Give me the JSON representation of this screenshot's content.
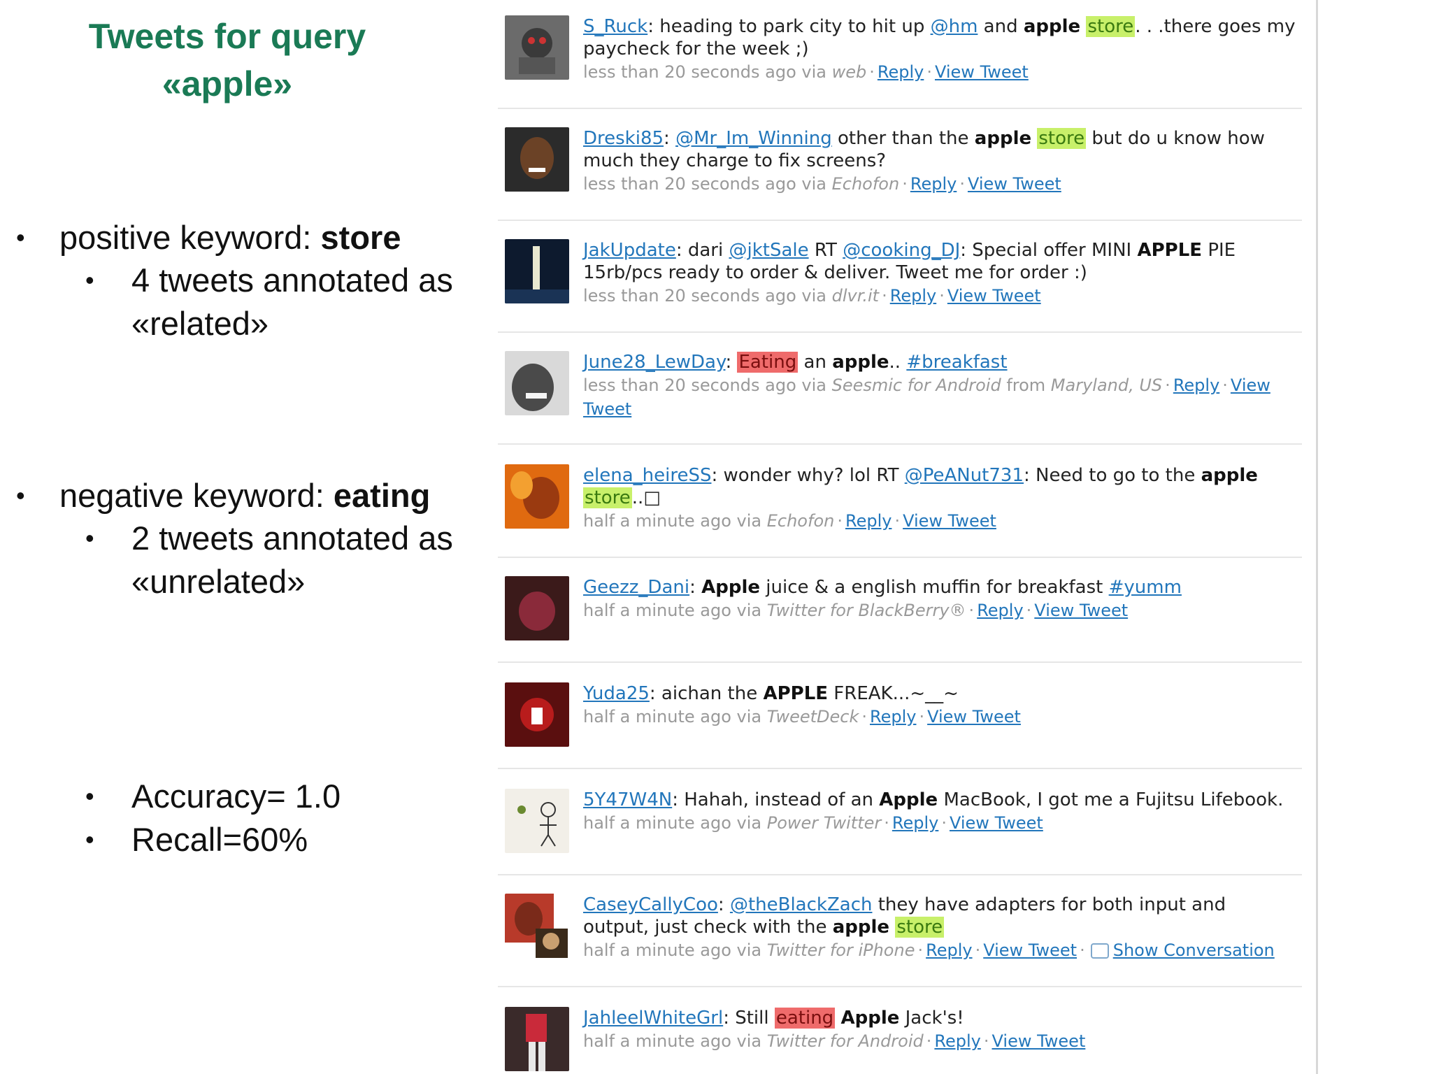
{
  "slide": {
    "title_line1": "Tweets for query",
    "title_line2": "«apple»",
    "positive_label": "positive keyword: ",
    "positive_keyword": "store",
    "positive_sub": "4 tweets annotated as «related»",
    "negative_label": "negative keyword: ",
    "negative_keyword": "eating",
    "negative_sub": "2 tweets annotated as «unrelated»",
    "accuracy": "Accuracy= 1.0",
    "recall": "Recall=60%",
    "bullet": "•"
  },
  "colors": {
    "title": "#1a7a55",
    "link": "#2276bb",
    "highlight_positive": "#c8f06a",
    "highlight_negative": "#ef6b6b"
  },
  "tweets": [
    {
      "user": "S_Ruck",
      "t1": ": heading to park city to hit up ",
      "mention": "@hm",
      "t2": " and ",
      "bold": "apple",
      "hl": "store",
      "t3": ". . .there goes my paycheck for the week ;)",
      "time": "less than 20 seconds ago via ",
      "via": "web",
      "reply": "Reply",
      "view": "View Tweet"
    },
    {
      "user": "Dreski85",
      "mention": "@Mr_Im_Winning",
      "t1": " other than the ",
      "bold": "apple",
      "hl": "store",
      "t2": " but do u know how much they charge to fix screens?",
      "time": "less than 20 seconds ago via ",
      "via": "Echofon",
      "reply": "Reply",
      "view": "View Tweet"
    },
    {
      "user": "JakUpdate",
      "t1": ": dari ",
      "mention1": "@jktSale",
      "t2": " RT ",
      "mention2": "@cooking_DJ",
      "t3": ": Special offer MINI ",
      "bold": "APPLE",
      "t4": " PIE 15rb/pcs ready to order & deliver. Tweet me for order :)",
      "time": "less than 20 seconds ago via ",
      "via": "dlvr.it",
      "reply": "Reply",
      "view": "View Tweet"
    },
    {
      "user": "June28_LewDay",
      "hl": "Eating",
      "t1": " an ",
      "bold": "apple",
      "t2": ".. ",
      "tag": "#breakfast",
      "time": "less than 20 seconds ago via ",
      "via": "Seesmic for Android",
      "from": " from ",
      "place": "Maryland, US",
      "reply": "Reply",
      "view": "View Tweet"
    },
    {
      "user": "elena_heireSS",
      "t1": ": wonder why? lol RT ",
      "mention": "@PeANut731",
      "t2": ": Need to go to the ",
      "bold": "apple",
      "hl": "store",
      "t3": "..□",
      "time": "half a minute ago via ",
      "via": "Echofon",
      "reply": "Reply",
      "view": "View Tweet"
    },
    {
      "user": "Geezz_Dani",
      "t1": ": ",
      "bold": "Apple",
      "t2": " juice & a english muffin for breakfast ",
      "tag": "#yumm",
      "time": "half a minute ago via ",
      "via": "Twitter for BlackBerry®",
      "reply": "Reply",
      "view": "View Tweet"
    },
    {
      "user": "Yuda25",
      "t1": ": aichan the ",
      "bold": "APPLE",
      "t2": " FREAK...~__~",
      "time": "half a minute ago via ",
      "via": "TweetDeck",
      "reply": "Reply",
      "view": "View Tweet"
    },
    {
      "user": "5Y47W4N",
      "t1": ": Hahah, instead of an ",
      "bold": "Apple",
      "t2": " MacBook, I got me a Fujitsu Lifebook.",
      "time": "half a minute ago via ",
      "via": "Power Twitter",
      "reply": "Reply",
      "view": "View Tweet"
    },
    {
      "user": "CaseyCallyCoo",
      "t1": ": ",
      "mention": "@theBlackZach",
      "t2": " they have adapters for both input and output, just check with the ",
      "bold": "apple",
      "hl": "store",
      "time": "half a minute ago via ",
      "via": "Twitter for iPhone",
      "reply": "Reply",
      "view": "View Tweet",
      "conversation": "Show Conversation"
    },
    {
      "user": "JahleelWhiteGrl",
      "t1": ": Still ",
      "hl": "eating",
      "bold": "Apple",
      "t2": " Jack's!",
      "time": "half a minute ago via ",
      "via": "Twitter for Android",
      "reply": "Reply",
      "view": "View Tweet"
    }
  ]
}
